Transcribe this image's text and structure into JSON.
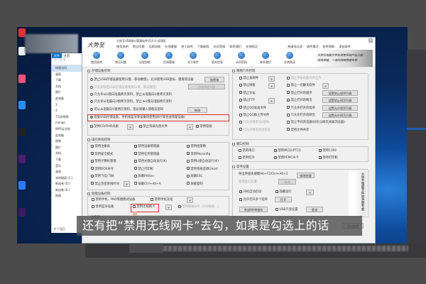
{
  "explorer": {
    "tabs": [
      "文件",
      "主页"
    ],
    "nav": [
      "快速访问",
      "桌面",
      "下载",
      "文档",
      "图片",
      "此电脑",
      "3",
      "4",
      "7月份视频",
      "mango",
      "WPS云文档",
      "此电脑",
      "视频",
      "图片",
      "文档",
      "下载",
      "音乐",
      "桌面",
      "本地磁盘 (C:)",
      "新加卷 (D:)",
      "新加卷 (E:)",
      "网络"
    ],
    "footer": "8 个项目"
  },
  "app": {
    "title": "大势至USB接口管理软件V14.0-试用版",
    "logo": "大势至",
    "menu": [
      "使用说明",
      "常见问题",
      "远程协助",
      "在线客服",
      "关于软件",
      "下载新版",
      "访问官网",
      "联系我们",
      "在线购买",
      "关键词过滤",
      "软件激活",
      "软件帮助",
      "退出软件"
    ],
    "toolbar": [
      "使用说明",
      "常见问题",
      "远程协助",
      "在线客服",
      "关于软件",
      "版本信息",
      "访问官网",
      "联系我们",
      "在线购买"
    ],
    "banner": [
      "大势至电脑文件防泄密系统产品介绍",
      "成就卓越，一流的网络管理专家"
    ],
    "storage": {
      "title": "存储设备控制",
      "options": [
        {
          "label": "禁止USB存储设备使用(U盘、移动硬盘)，允许使用USB鼠标、键盘等设备",
          "selected": false,
          "disabled": false
        },
        {
          "label": "只允许特定USB存储设备使用(U盘、移动硬盘)",
          "selected": false,
          "disabled": true
        },
        {
          "label": "只允许从U盘向电脑拷贝资料，禁止从电脑向U盘拷贝资料",
          "selected": false,
          "disabled": false
        },
        {
          "label": "只允许从电脑向U盘拷贝资料，禁止从U盘向电脑拷贝资料",
          "selected": false,
          "disabled": false
        },
        {
          "label": "可以从电脑向U盘拷贝资料，但必须输入管理员密码",
          "selected": false,
          "disabled": false
        },
        {
          "label": "恢复USB存储设备，手机或蓝牙等设备的使用(网卡等也会恢复设备)",
          "selected": true,
          "disabled": false
        }
      ],
      "btn_dongle": "加密狗",
      "btn_add_usb": "添加特定U盘",
      "btn_modify": "修改",
      "checks": [
        {
          "label": "禁用CD/DVD光驱",
          "checked": false
        },
        {
          "label": "禁止刻录光盘文件",
          "checked": false
        },
        {
          "label": "禁用软驱",
          "checked": false
        }
      ],
      "plus": "+"
    },
    "os": {
      "title": "操作系统控制",
      "items": [
        {
          "label": "禁用注册表",
          "checked": true
        },
        {
          "label": "禁用设备管理器",
          "checked": true
        },
        {
          "label": "禁用组策略",
          "checked": true
        },
        {
          "label": "禁用安全模式",
          "checked": true
        },
        {
          "label": "禁用任务管理器",
          "checked": true
        },
        {
          "label": "禁用Msconfig",
          "checked": true
        },
        {
          "label": "禁用计算机管理",
          "checked": true
        },
        {
          "label": "禁用光盘自动运行(K)",
          "checked": false
        },
        {
          "label": "禁用U盘自动运行(K)",
          "checked": false
        },
        {
          "label": "禁用DOS命令",
          "checked": true
        },
        {
          "label": "禁止打印机",
          "checked": false
        },
        {
          "label": "禁用系统还原Ghost",
          "checked": true
        },
        {
          "label": "禁用飞信/飞秋",
          "checked": true
        },
        {
          "label": "屏蔽PrtScn",
          "checked": false
        },
        {
          "label": "屏蔽ESC",
          "checked": false
        },
        {
          "label": "禁止改变系统时间",
          "checked": true
        },
        {
          "label": "屏蔽Ctrl+Alt+A",
          "checked": false
        },
        {
          "label": "屏蔽复制",
          "checked": false
        }
      ]
    },
    "smart": {
      "title": "智能设备控制",
      "items": [
        {
          "label": "禁用手机、PAD等便携式设备",
          "checked": false
        },
        {
          "label": "禁用手机充电",
          "checked": false
        },
        {
          "label": "禁用蓝牙设备",
          "checked": false
        },
        {
          "label": "禁用无线网卡",
          "checked": false
        },
        {
          "label": "禁用随身wifi（360随身...）",
          "checked": false
        }
      ],
      "ip_label": "本机IP："
    },
    "network": {
      "title": "网络行为控制",
      "left": [
        {
          "label": "禁止发邮件",
          "checked": false,
          "plus": true
        },
        {
          "label": "禁止网盘",
          "checked": false,
          "plus": true
        },
        {
          "label": "禁止论坛",
          "checked": false
        },
        {
          "label": "禁止FTP",
          "checked": false,
          "plus": true
        },
        {
          "label": "禁止QQ发送文件",
          "checked": false
        },
        {
          "label": "禁止QQ群上传文件",
          "checked": false
        },
        {
          "label": "只允许特定QQ登陆",
          "checked": false,
          "disabled": true
        },
        {
          "label": "只允许特定阿里旺旺",
          "checked": false,
          "disabled": true
        }
      ],
      "right": [
        {
          "label": "禁止手机电脑文件互传",
          "checked": false,
          "disabled": true
        },
        {
          "label": "禁止一切聊天软件",
          "checked": false,
          "plus": true
        },
        {
          "label": "禁止打开的程序",
          "checked": true,
          "button": "设置禁止程序列表"
        },
        {
          "label": "禁止打开的网页",
          "checked": true,
          "button": "设置禁止网页列表"
        },
        {
          "label": "只允许打开的程序",
          "checked": false,
          "button": "设置允许程序列表"
        },
        {
          "label": "只允许打开的网页",
          "checked": false,
          "button": "设置允许网页列表"
        },
        {
          "label": "禁止不同浏览器访问(与网页关联浏览器)",
          "checked": false
        },
        {
          "label": "禁用文件共享",
          "checked": false
        }
      ]
    },
    "ports": {
      "title": "端口控制",
      "items": [
        {
          "label": "禁用串口",
          "checked": false
        },
        {
          "label": "禁用并口(LPT口)",
          "checked": false
        },
        {
          "label": "禁用1394",
          "checked": false
        },
        {
          "label": "禁用红外",
          "checked": false
        },
        {
          "label": "禁用PCMCIA卡",
          "checked": false
        },
        {
          "label": "禁用打印机",
          "checked": false
        }
      ]
    },
    "settings": {
      "title": "软件设置",
      "hotkey": "呼出界面快捷键Alt+F2/Ctrl+Alt+2",
      "btn_hotkey": "修改热键",
      "password": "管理密码设置",
      "btn_password": "修改",
      "autostart": {
        "label": "开机自动启动",
        "checked": true
      },
      "hidden": {
        "label": "隐藏运行",
        "checked": true
      },
      "allow_open": {
        "label": "允许打开多个程序",
        "checked": false
      },
      "btn_open": "打开",
      "btn_wan": "关闭WAN服务",
      "usb_readonly": {
        "label": "USB只读设置",
        "checked": false
      },
      "btn_login": "登录",
      "calligraphy": "大势至电脑文件防泄密专家",
      "btn_exit": "退出软件"
    }
  },
  "subtitle": "还有把“禁用无线网卡”去勾，如果是勾选上的话",
  "colors": {
    "highlight": "#e0322b",
    "accent": "#145aa8"
  }
}
